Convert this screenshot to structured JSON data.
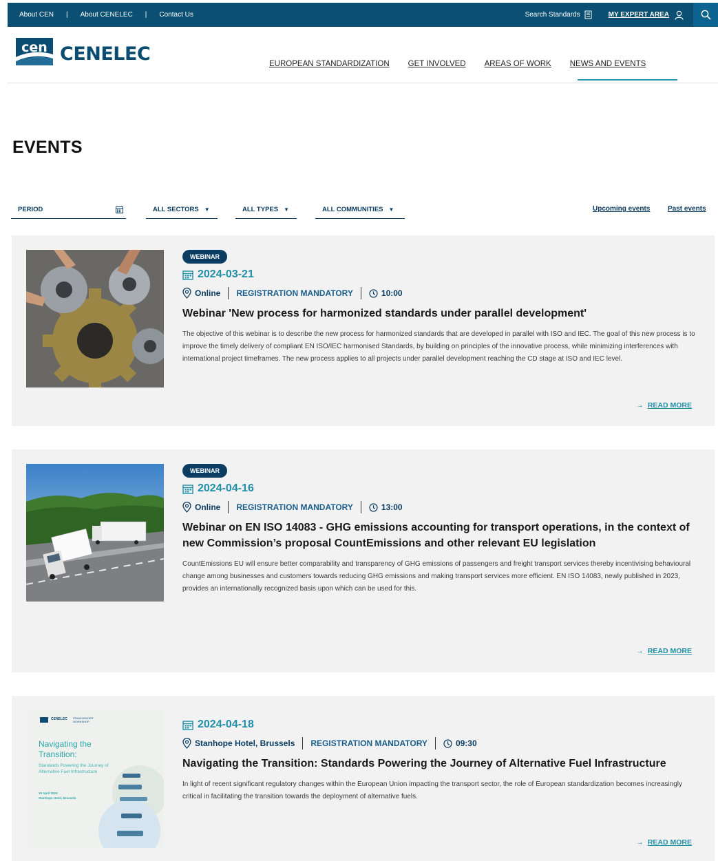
{
  "topbar": {
    "links": [
      "About CEN",
      "About CENELEC",
      "Contact Us"
    ],
    "search_standards": "Search Standards",
    "expert_area": "MY EXPERT AREA"
  },
  "header": {
    "logo_mark": "cen",
    "logo_word": "CENELEC",
    "nav": [
      "EUROPEAN STANDARDIZATION",
      "GET INVOLVED",
      "AREAS OF WORK",
      "NEWS AND EVENTS"
    ],
    "active_nav": "NEWS AND EVENTS"
  },
  "page": {
    "title": "EVENTS"
  },
  "filters": {
    "period": "PERIOD",
    "sectors": "ALL SECTORS",
    "types": "ALL TYPES",
    "communities": "ALL COMMUNITIES",
    "upcoming": "Upcoming events",
    "past": "Past events"
  },
  "events": [
    {
      "badge": "WEBINAR",
      "date": "2024-03-21",
      "location": "Online",
      "registration": "REGISTRATION MANDATORY",
      "time": "10:00",
      "title": "Webinar 'New process for harmonized standards under parallel development'",
      "description": "The objective of this webinar is to describe the new process for harmonized standards that are developed in parallel with ISO and IEC. The goal of this new process is to improve the timely delivery of compliant EN ISO/IEC harmonised Standards, by building on principles of the innovative process, while minimizing interferences with international project timeframes. The new process applies to all projects under parallel development reaching the CD stage at ISO and IEC level.",
      "read_more": "READ MORE"
    },
    {
      "badge": "WEBINAR",
      "date": "2024-04-16",
      "location": "Online",
      "registration": "REGISTRATION MANDATORY",
      "time": "13:00",
      "title": "Webinar on EN ISO 14083 - GHG emissions accounting for transport operations, in the context of new Commission’s proposal CountEmissions and other relevant EU legislation",
      "description": "CountEmissions EU will ensure better comparability and transparency of GHG emissions of passengers and freight transport services thereby incentivising behavioural change among businesses and customers towards reducing GHG emissions and making transport services more efficient. EN ISO 14083, newly published in 2023, provides an internationally recognized basis upon which can be used for this.",
      "read_more": "READ MORE"
    },
    {
      "badge": "",
      "date": "2024-04-18",
      "location": "Stanhope Hotel, Brussels",
      "registration": "REGISTRATION MANDATORY",
      "time": "09:30",
      "title": "Navigating the Transition: Standards Powering the Journey of Alternative Fuel Infrastructure",
      "description": "In light of recent significant regulatory changes within the European Union impacting the transport sector, the role of European standardization becomes increasingly critical in facilitating the transition towards the deployment of alternative fuels.",
      "read_more": "READ MORE",
      "thumb_text": {
        "header_left": "CENELEC",
        "header_right": "STAKEHOLDER WORKSHOP",
        "heading": "Navigating the Transition:",
        "sub": "Standards Powering the Journey of Alternative Fuel Infrastructure",
        "date": "18 April 2024",
        "venue": "Stanhope Hotel, Brussels"
      }
    }
  ],
  "colors": {
    "brand": "#0b5073",
    "navy": "#0b3d63",
    "teal": "#1f8fa8",
    "card": "#f2f2f2"
  }
}
